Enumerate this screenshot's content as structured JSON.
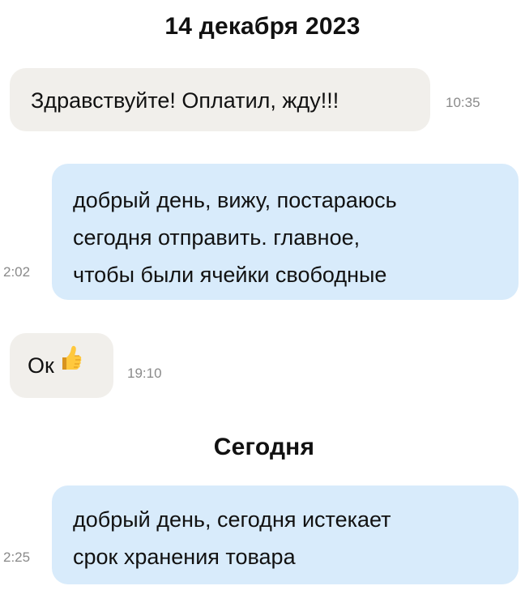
{
  "conversation": {
    "date_separator_1": "14 декабря 2023",
    "date_separator_2": "Сегодня",
    "messages": [
      {
        "direction": "incoming",
        "lines": [
          "Здравствуйте! Оплатил, жду!!!"
        ],
        "time": "10:35"
      },
      {
        "direction": "outgoing",
        "lines": [
          "добрый день, вижу, постараюсь",
          "сегодня отправить. главное,",
          "чтобы были ячейки свободные"
        ],
        "time": "2:02"
      },
      {
        "direction": "incoming",
        "text": "Ок",
        "emoji": "thumbs-up-icon",
        "time": "19:10"
      },
      {
        "direction": "outgoing",
        "lines": [
          "добрый день, сегодня истекает",
          "срок хранения товара"
        ],
        "time": "2:25"
      }
    ]
  },
  "colors": {
    "incoming_bubble": "#f1efeb",
    "outgoing_bubble": "#d8ebfb",
    "time_text": "#8a8a8a",
    "text": "#111111"
  }
}
